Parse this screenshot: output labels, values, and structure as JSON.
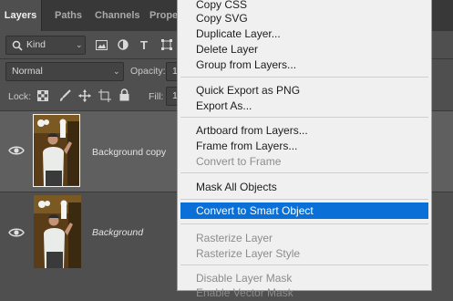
{
  "panel": {
    "tabs": [
      "Layers",
      "Paths",
      "Channels",
      "Prope"
    ],
    "filter_kind": "Kind",
    "blend_mode": "Normal",
    "opacity_label": "Opacity:",
    "opacity_value": "1",
    "lock_label": "Lock:",
    "fill_label": "Fill:",
    "fill_value": "1",
    "layers": [
      {
        "name": "Background copy",
        "selected": true
      },
      {
        "name": "Background",
        "selected": false
      }
    ]
  },
  "menu": {
    "groups": [
      [
        {
          "label": "Copy CSS",
          "disabled": false
        },
        {
          "label": "Copy SVG",
          "disabled": false
        },
        {
          "label": "Duplicate Layer...",
          "disabled": false
        },
        {
          "label": "Delete Layer",
          "disabled": false
        },
        {
          "label": "Group from Layers...",
          "disabled": false
        }
      ],
      [
        {
          "label": "Quick Export as PNG",
          "disabled": false
        },
        {
          "label": "Export As...",
          "disabled": false
        }
      ],
      [
        {
          "label": "Artboard from Layers...",
          "disabled": false
        },
        {
          "label": "Frame from Layers...",
          "disabled": false
        },
        {
          "label": "Convert to Frame",
          "disabled": true
        }
      ],
      [
        {
          "label": "Mask All Objects",
          "disabled": false
        }
      ],
      [
        {
          "label": "Convert to Smart Object",
          "disabled": false,
          "highlighted": true
        }
      ],
      [
        {
          "label": "Rasterize Layer",
          "disabled": true
        },
        {
          "label": "Rasterize Layer Style",
          "disabled": true
        }
      ],
      [
        {
          "label": "Disable Layer Mask",
          "disabled": true
        },
        {
          "label": "Enable Vector Mask",
          "disabled": true
        }
      ]
    ]
  },
  "colors": {
    "panel_bg": "#4f4f4f",
    "tabbar_bg": "#383838",
    "selected_layer_bg": "#5f5f5f",
    "menu_bg": "#f0f0f0",
    "menu_highlight": "#0a6fd6"
  }
}
